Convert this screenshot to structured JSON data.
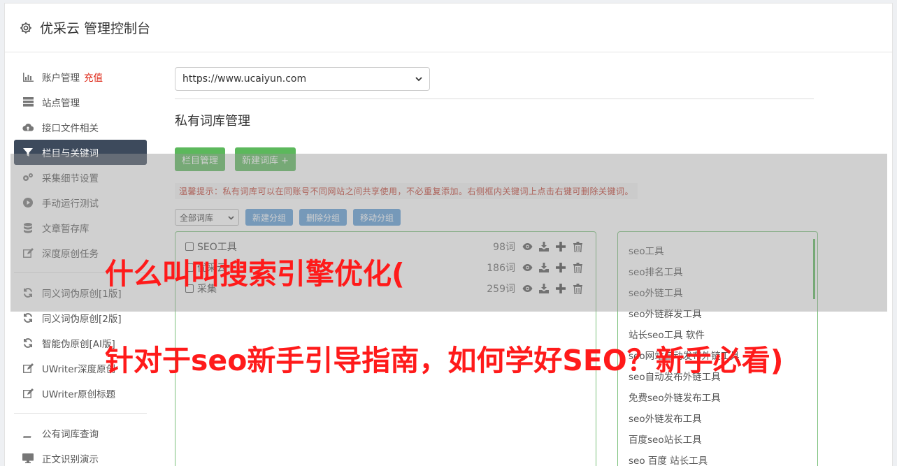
{
  "header": {
    "title": "优采云 管理控制台",
    "icon": "gear-icon"
  },
  "sidebar": {
    "items": [
      {
        "label": "账户管理",
        "badge": "充值",
        "icon": "bar-chart-icon"
      },
      {
        "label": "站点管理",
        "icon": "server-icon"
      },
      {
        "label": "接口文件相关",
        "icon": "cloud-upload-icon"
      },
      {
        "label": "栏目与关键词",
        "icon": "filter-icon",
        "active": true
      },
      {
        "label": "采集细节设置",
        "icon": "cogs-icon"
      },
      {
        "label": "手动运行测试",
        "icon": "play-circle-icon"
      },
      {
        "label": "文章暂存库",
        "icon": "database-icon"
      },
      {
        "label": "深度原创任务",
        "icon": "edit-icon"
      }
    ],
    "items2": [
      {
        "label": "同义词伪原创[1版]",
        "icon": "refresh-icon"
      },
      {
        "label": "同义词伪原创[2版]",
        "icon": "refresh-icon"
      },
      {
        "label": "智能伪原创[AI版]",
        "icon": "refresh-icon"
      },
      {
        "label": "UWriter深度原创",
        "icon": "edit-icon"
      },
      {
        "label": "UWriter原创标题",
        "icon": "edit-icon"
      }
    ],
    "items3": [
      {
        "label": "公有词库查询",
        "icon": "book-icon"
      },
      {
        "label": "正文识别演示",
        "icon": "monitor-icon"
      }
    ]
  },
  "main": {
    "site_select": "https://www.ucaiyun.com",
    "page_title": "私有词库管理",
    "btn_columns": "栏目管理",
    "btn_new_lib": "新建词库 +",
    "tip": "温馨提示：私有词库可以在同账号不同网站之间共享使用，不必重复添加。右侧框内关键词上点击右键可删除关键词。",
    "group_select": "全部词库",
    "btn_new_group": "新建分组",
    "btn_del_group": "删除分组",
    "btn_move_group": "移动分组",
    "libraries": [
      {
        "name": "SEO工具",
        "count": "98词"
      },
      {
        "name": "优采云",
        "count": "186词"
      },
      {
        "name": "采集",
        "count": "259词"
      }
    ],
    "keywords": [
      "seo工具",
      "seo排名工具",
      "seo外链工具",
      "seo外链群发工具",
      "站长seo工具 软件",
      "seo网站自动发布外链工具",
      "seo自动发布外链工具",
      "免费seo外链发布工具",
      "seo外链发布工具",
      "百度seo站长工具",
      "seo 百度 站长工具"
    ]
  },
  "overlay_text": {
    "line1": "什么叫叫搜索引擎优化(",
    "line2": "针对于seo新手引导指南，如何学好SEO？新手必看)"
  },
  "colors": {
    "accent_green": "#5cb85c",
    "accent_blue": "#5b9bd5",
    "active_nav": "#3d4a5c",
    "overlay_red": "#ff1a1a"
  }
}
